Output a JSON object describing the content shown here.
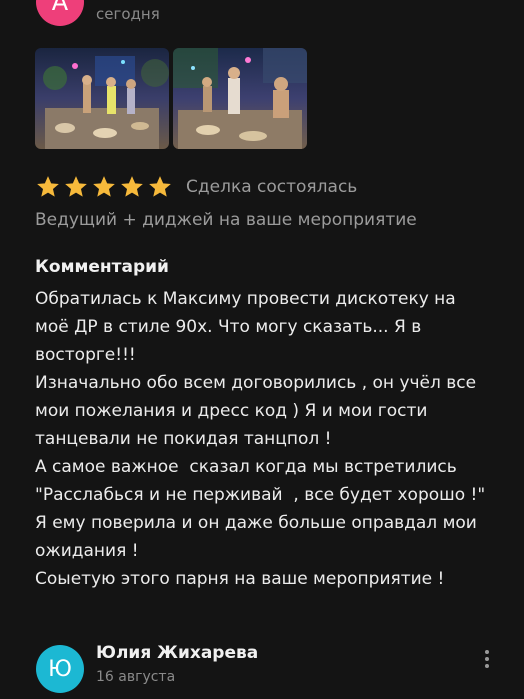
{
  "review_1": {
    "avatar_letter": "А",
    "date": "сегодня",
    "rating": 5,
    "deal_status": "Сделка состоялась",
    "service": "Ведущий + диджей на ваше мероприятие",
    "comment_heading": "Комментарий",
    "comment_lines": [
      "Обратилась к Максиму провести дискотеку на",
      "моё ДР в стиле 90х. Что могу сказать... Я в",
      "восторге!!!",
      "Изначально обо всем договорились , он учёл все",
      "мои пожелания и дресс код ) Я и мои гости",
      "танцевали не покидая танцпол !",
      "А самое важное  сказал когда мы встретились",
      "\"Расслабься и не перживай  , все будет хорошо !\"",
      "Я ему поверила и он даже больше оправдал мои",
      "ожидания !",
      "Соыетую этого парня на ваше мероприятие !"
    ]
  },
  "review_2": {
    "avatar_letter": "Ю",
    "name": "Юлия Жихарева",
    "date": "16 августа"
  },
  "icons": {
    "star": "star-icon",
    "more": "more-vertical-icon"
  },
  "colors": {
    "background": "#141414",
    "star": "#f6b93b",
    "avatar_a": "#ee3f7a",
    "avatar_yu": "#1cb8d3",
    "muted_text": "#9b9b9b"
  }
}
